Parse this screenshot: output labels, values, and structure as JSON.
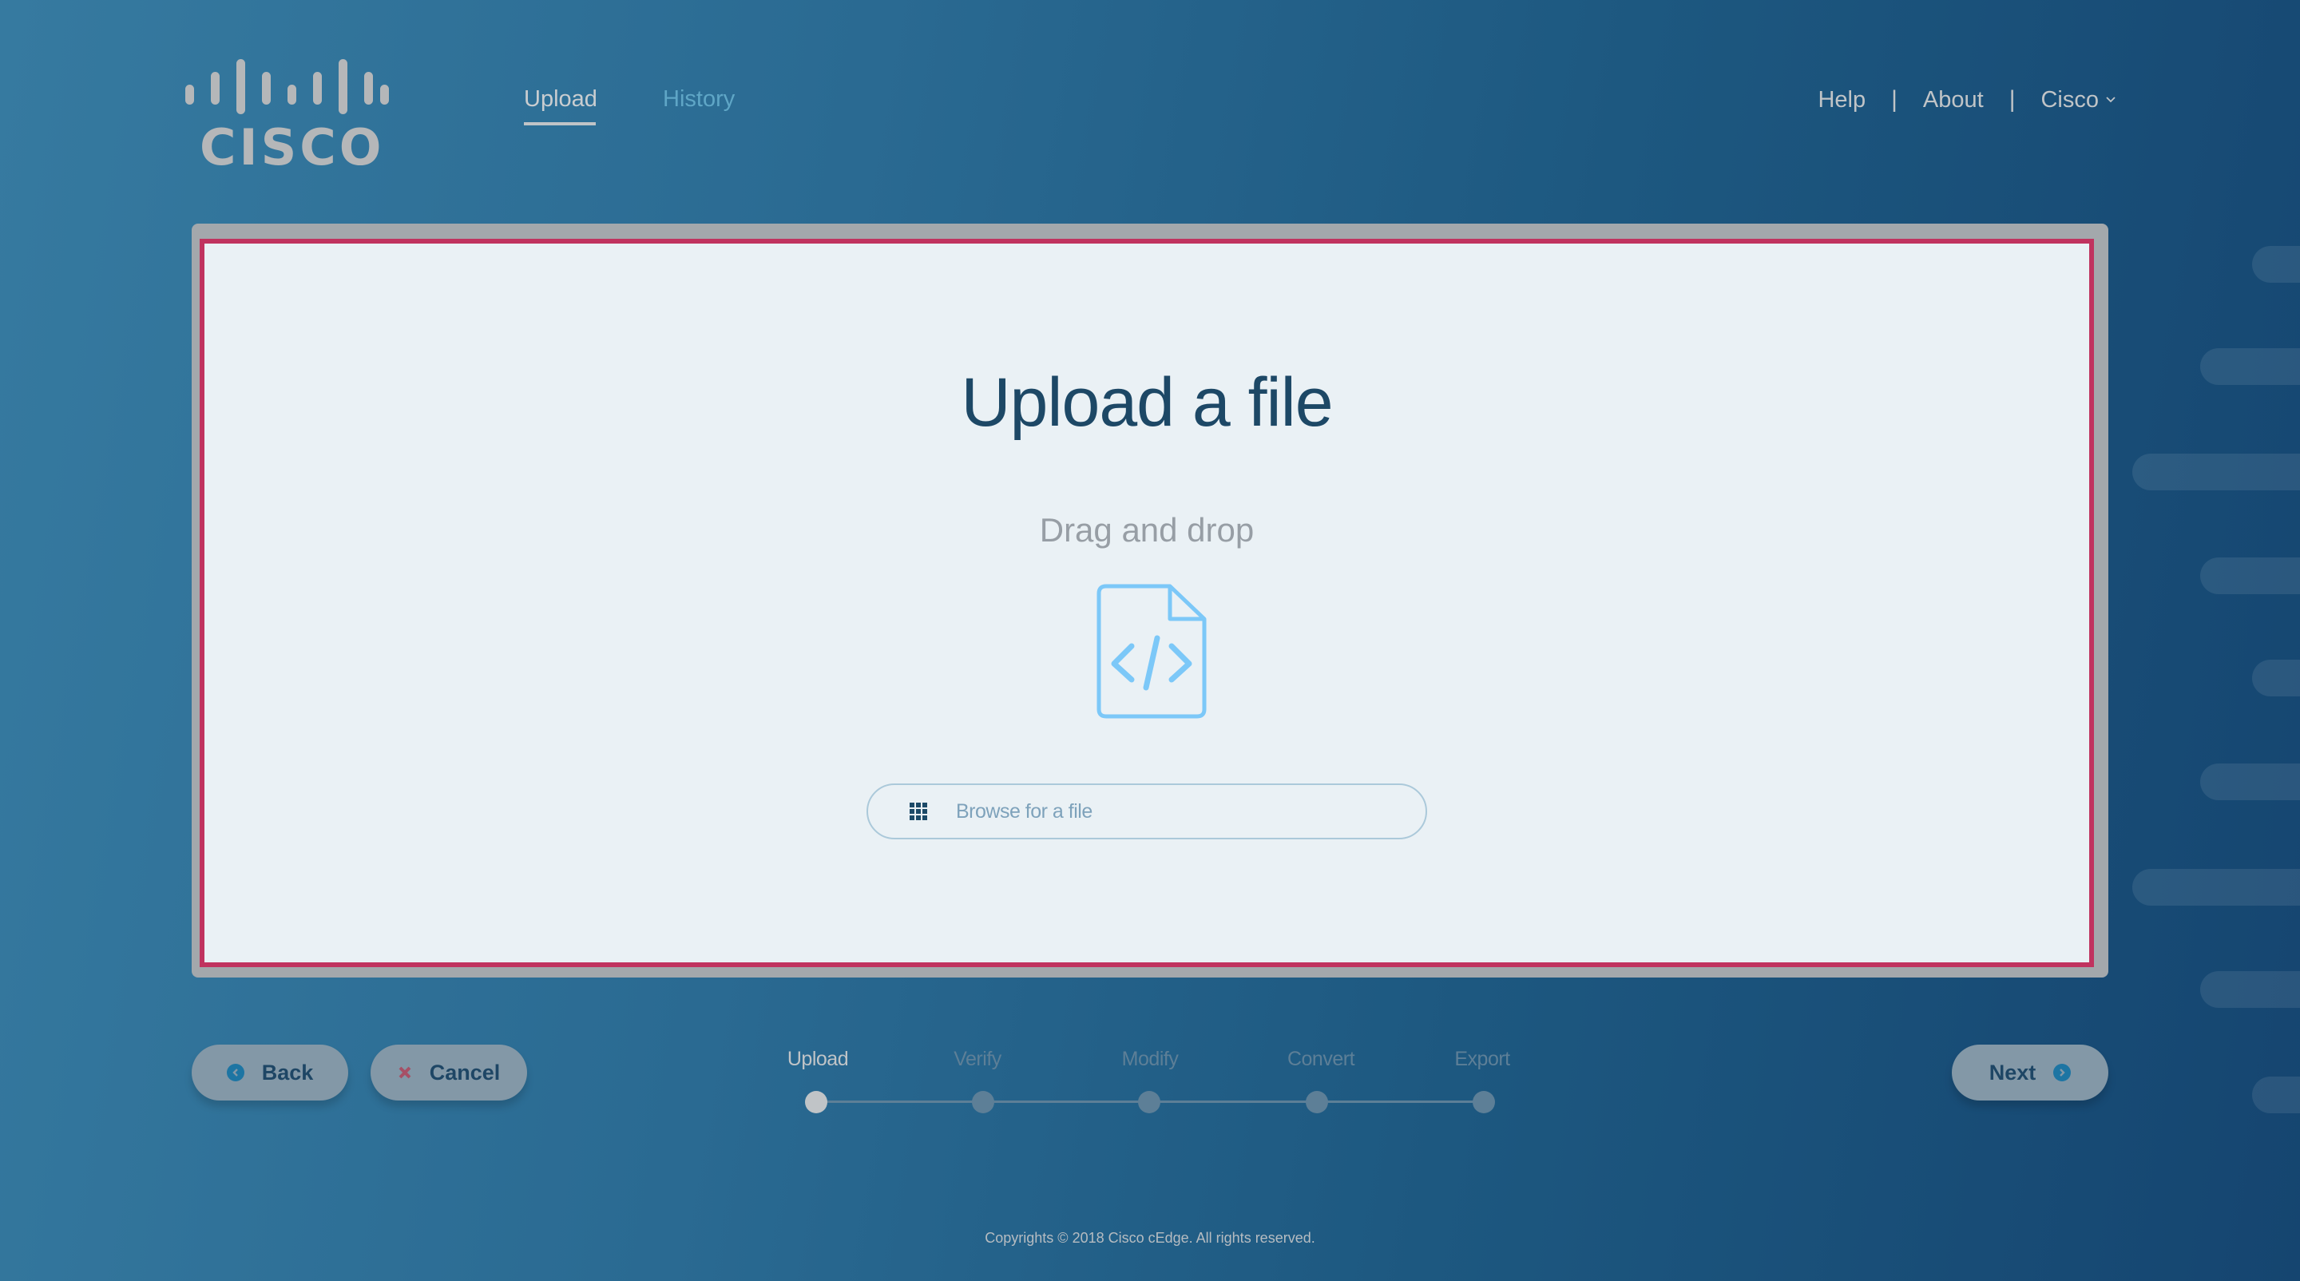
{
  "header": {
    "logo_text": "CISCO",
    "tabs": [
      {
        "label": "Upload",
        "active": true
      },
      {
        "label": "History",
        "active": false
      }
    ],
    "links": {
      "help": "Help",
      "about": "About",
      "account": "Cisco",
      "separator": "|"
    }
  },
  "main": {
    "title": "Upload a file",
    "subtitle": "Drag and drop",
    "icon": "file-code-icon",
    "browse_placeholder": "Browse for a file",
    "browse_icon": "grid-icon"
  },
  "actions": {
    "back_label": "Back",
    "cancel_label": "Cancel",
    "next_label": "Next"
  },
  "stepper": {
    "steps": [
      {
        "label": "Upload",
        "active": true
      },
      {
        "label": "Verify",
        "active": false
      },
      {
        "label": "Modify",
        "active": false
      },
      {
        "label": "Convert",
        "active": false
      },
      {
        "label": "Export",
        "active": false
      }
    ],
    "current_step": 1
  },
  "footer": {
    "copyright": "Copyrights © 2018 Cisco cEdge. All rights reserved."
  },
  "colors": {
    "accent": "#1d75a3",
    "panel_border": "#c0335f",
    "panel_bg": "#eaf1f5",
    "title": "#1d4866",
    "icon": "#7cc8f8",
    "cancel_x": "#a65066"
  }
}
